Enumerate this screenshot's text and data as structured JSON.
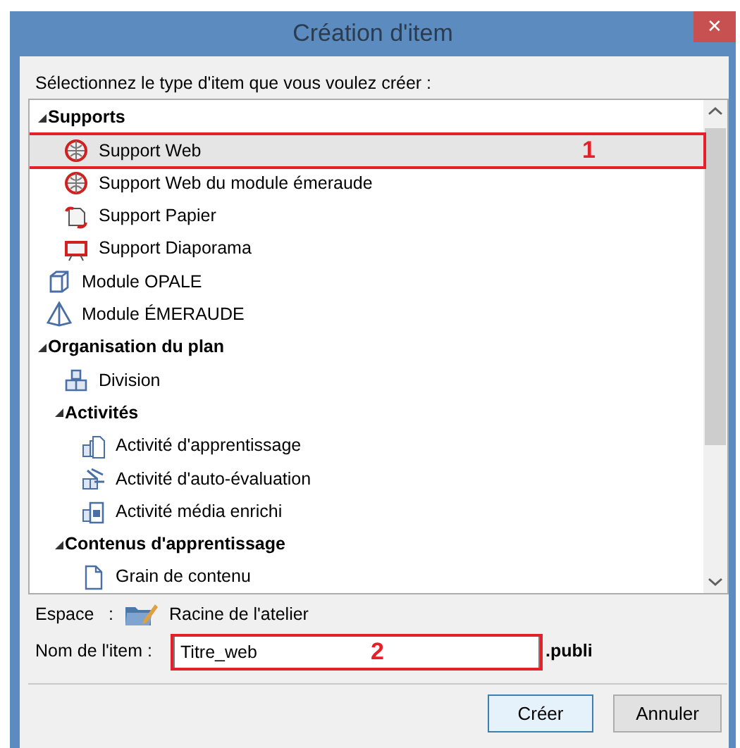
{
  "window": {
    "title": "Création d'item",
    "close_symbol": "✕"
  },
  "instruction": "Sélectionnez le type d'item que vous voulez créer :",
  "tree": [
    {
      "label": "Supports",
      "expanded": true,
      "selected": false,
      "children": [
        {
          "label": "Support Web",
          "kind": "web",
          "selected": true,
          "annotation": "1"
        },
        {
          "label": "Support Web du module émeraude",
          "kind": "web",
          "selected": false
        },
        {
          "label": "Support Papier",
          "kind": "paper",
          "selected": false
        },
        {
          "label": "Support Diaporama",
          "kind": "slides",
          "selected": false
        }
      ]
    },
    {
      "label": "Module OPALE",
      "kind": "cube",
      "selected": false
    },
    {
      "label": "Module ÉMERAUDE",
      "kind": "pyramid",
      "selected": false
    },
    {
      "label": "Organisation du plan",
      "expanded": true,
      "selected": false,
      "children": [
        {
          "label": "Division",
          "kind": "blocks",
          "selected": false
        },
        {
          "label": "Activités",
          "expanded": true,
          "selected": false,
          "children": [
            {
              "label": "Activité d'apprentissage",
              "kind": "activity",
              "selected": false
            },
            {
              "label": "Activité d'auto-évaluation",
              "kind": "quiz",
              "selected": false
            },
            {
              "label": "Activité média enrichi",
              "kind": "media",
              "selected": false
            }
          ]
        },
        {
          "label": "Contenus d'apprentissage",
          "expanded": true,
          "selected": false,
          "children": [
            {
              "label": "Grain de contenu",
              "kind": "page",
              "selected": false
            }
          ]
        }
      ]
    }
  ],
  "space": {
    "label": "Espace",
    "separator": ":",
    "value": "Racine de l'atelier"
  },
  "name_field": {
    "label": "Nom de l'item :",
    "value": "Titre_web",
    "suffix": ".publi",
    "annotation": "2"
  },
  "buttons": [
    {
      "label": "Créer",
      "focused": true
    },
    {
      "label": "Annuler",
      "focused": false
    }
  ]
}
